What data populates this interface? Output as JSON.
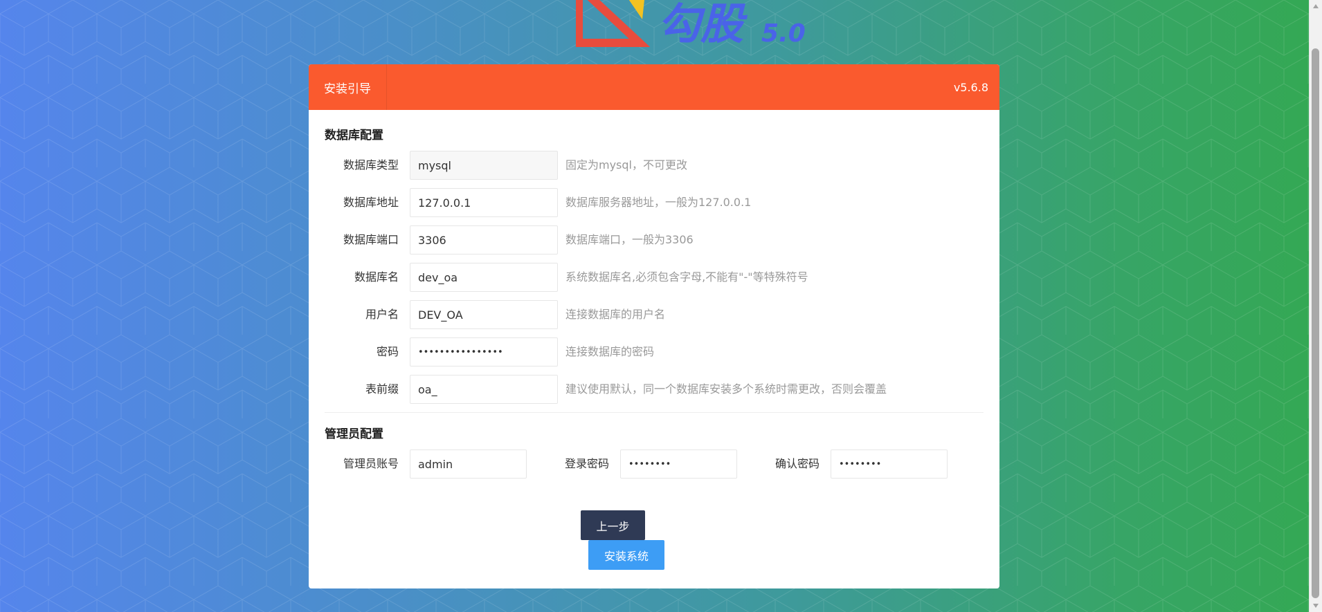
{
  "logo": {
    "text": "勾股",
    "version": "5.0",
    "icon": "triangle-logo-icon"
  },
  "header": {
    "tab_label": "安装引导",
    "version": "v5.6.8"
  },
  "database": {
    "section_title": "数据库配置",
    "fields": [
      {
        "label": "数据库类型",
        "value": "mysql",
        "hint": "固定为mysql，不可更改",
        "readonly": true
      },
      {
        "label": "数据库地址",
        "value": "127.0.0.1",
        "hint": "数据库服务器地址，一般为127.0.0.1"
      },
      {
        "label": "数据库端口",
        "value": "3306",
        "hint": "数据库端口，一般为3306"
      },
      {
        "label": "数据库名",
        "value": "dev_oa",
        "hint": "系统数据库名,必须包含字母,不能有\"-\"等特殊符号"
      },
      {
        "label": "用户名",
        "value": "DEV_OA",
        "hint": "连接数据库的用户名"
      },
      {
        "label": "密码",
        "value": "••••••••••••••••",
        "hint": "连接数据库的密码",
        "password": true
      },
      {
        "label": "表前缀",
        "value": "oa_",
        "hint": "建议使用默认，同一个数据库安装多个系统时需更改，否则会覆盖"
      }
    ]
  },
  "admin": {
    "section_title": "管理员配置",
    "account_label": "管理员账号",
    "account_value": "admin",
    "password_label": "登录密码",
    "password_value": "••••••••",
    "confirm_label": "确认密码",
    "confirm_value": "••••••••"
  },
  "buttons": {
    "prev": "上一步",
    "install": "安装系统"
  },
  "colors": {
    "header": "#fa5a2e",
    "prev_button": "#2f3a55",
    "install_button": "#3d9df5",
    "bg_left": "#5585ec",
    "bg_right": "#34a853"
  }
}
